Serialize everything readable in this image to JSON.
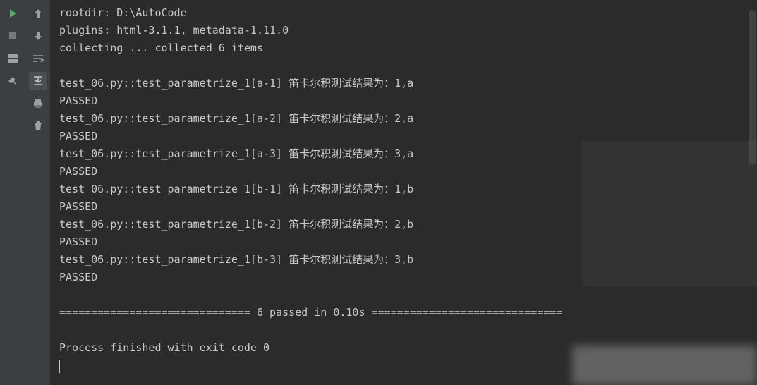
{
  "gutter1": {
    "run": {
      "icon": "run-icon"
    },
    "stop": {
      "icon": "stop-icon"
    },
    "layout": {
      "icon": "layout-icon"
    },
    "pin": {
      "icon": "pin-icon"
    }
  },
  "gutter2": {
    "up": {
      "icon": "arrow-up-icon"
    },
    "down": {
      "icon": "arrow-down-icon"
    },
    "wrap": {
      "icon": "soft-wrap-icon"
    },
    "scroll": {
      "icon": "scroll-to-end-icon"
    },
    "print": {
      "icon": "print-icon"
    },
    "trash": {
      "icon": "trash-icon"
    }
  },
  "console": {
    "lines": [
      "rootdir: D:\\AutoCode",
      "plugins: html-3.1.1, metadata-1.11.0",
      "collecting ... collected 6 items",
      "",
      "test_06.py::test_parametrize_1[a-1] 笛卡尔积测试结果为：1,a",
      "PASSED",
      "test_06.py::test_parametrize_1[a-2] 笛卡尔积测试结果为：2,a",
      "PASSED",
      "test_06.py::test_parametrize_1[a-3] 笛卡尔积测试结果为：3,a",
      "PASSED",
      "test_06.py::test_parametrize_1[b-1] 笛卡尔积测试结果为：1,b",
      "PASSED",
      "test_06.py::test_parametrize_1[b-2] 笛卡尔积测试结果为：2,b",
      "PASSED",
      "test_06.py::test_parametrize_1[b-3] 笛卡尔积测试结果为：3,b",
      "PASSED",
      "",
      "============================== 6 passed in 0.10s ==============================",
      "",
      "Process finished with exit code 0"
    ]
  }
}
